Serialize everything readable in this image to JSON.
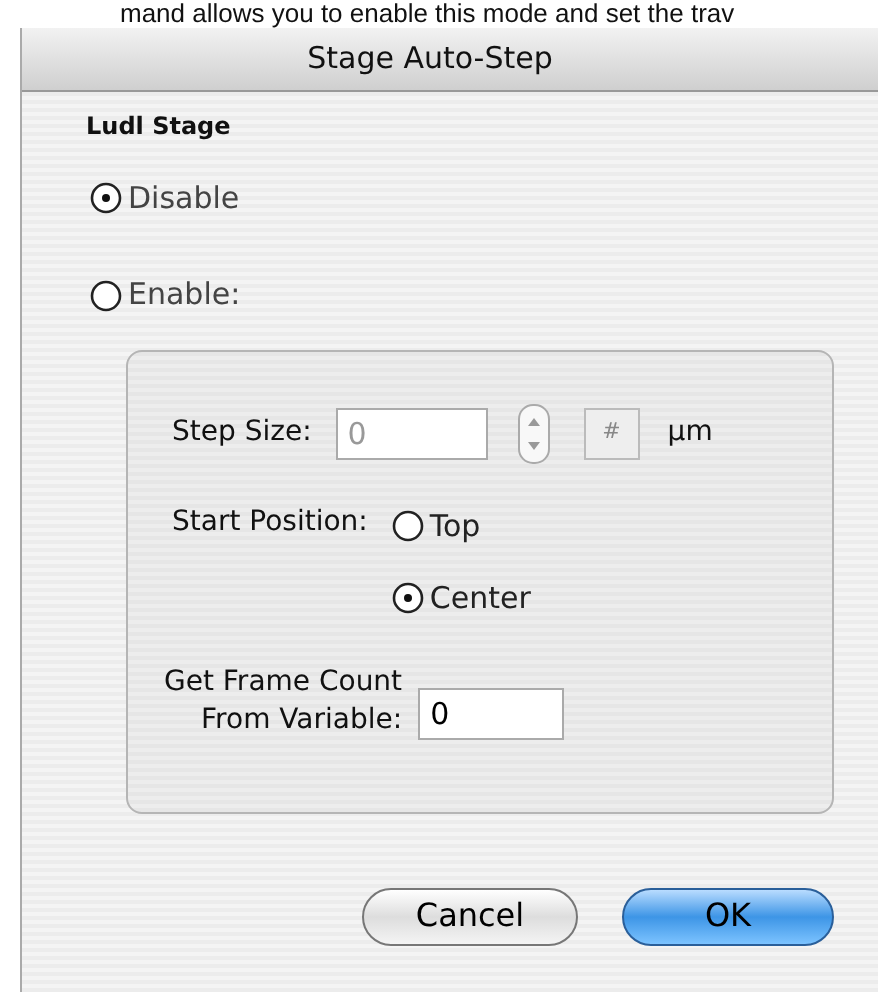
{
  "caption": "mand allows you to enable this mode and set the trav",
  "window": {
    "title": "Stage Auto-Step"
  },
  "section_title": "Ludl Stage",
  "mode_options": [
    {
      "label": "Disable",
      "selected": true
    },
    {
      "label": "Enable:",
      "selected": false
    }
  ],
  "step_size": {
    "label": "Step Size:",
    "value": "0",
    "disabled": true,
    "format_button": "#",
    "unit": "µm"
  },
  "start_position": {
    "label": "Start Position:",
    "options": [
      {
        "label": "Top",
        "selected": false
      },
      {
        "label": "Center",
        "selected": true
      }
    ]
  },
  "frame_count": {
    "label_lines": [
      "Get Frame Count",
      "From Variable:"
    ],
    "value": "0"
  },
  "buttons": [
    {
      "label": "Cancel",
      "kind": "secondary"
    },
    {
      "label": "OK",
      "kind": "default"
    }
  ]
}
